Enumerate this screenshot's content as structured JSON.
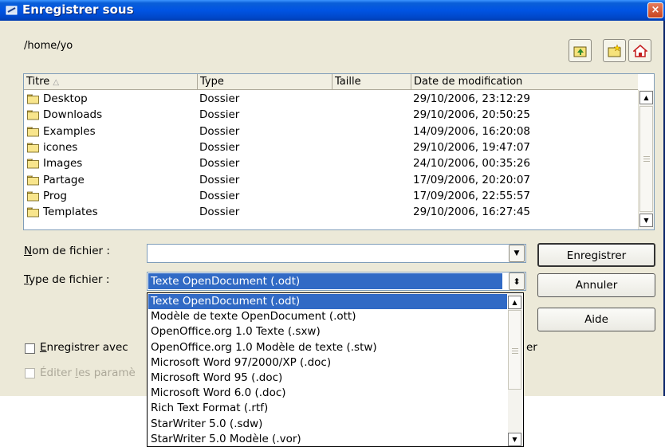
{
  "window": {
    "title": "Enregistrer sous",
    "close_glyph": "×",
    "current_path": "/home/yo",
    "toolbar": {
      "up_icon": "folder-up-icon",
      "new_folder_icon": "new-folder-icon",
      "home_icon": "home-icon"
    }
  },
  "file_list": {
    "columns": [
      "Titre",
      "Type",
      "Taille",
      "Date de modification"
    ],
    "sort_indicator": "△",
    "rows": [
      {
        "name": "Desktop",
        "type": "Dossier",
        "size": "",
        "date": "29/10/2006, 23:12:29"
      },
      {
        "name": "Downloads",
        "type": "Dossier",
        "size": "",
        "date": "29/10/2006, 20:50:25"
      },
      {
        "name": "Examples",
        "type": "Dossier",
        "size": "",
        "date": "14/09/2006, 16:20:08"
      },
      {
        "name": "icones",
        "type": "Dossier",
        "size": "",
        "date": "29/10/2006, 19:47:07"
      },
      {
        "name": "Images",
        "type": "Dossier",
        "size": "",
        "date": "24/10/2006, 00:35:26"
      },
      {
        "name": "Partage",
        "type": "Dossier",
        "size": "",
        "date": "17/09/2006, 20:20:07"
      },
      {
        "name": "Prog",
        "type": "Dossier",
        "size": "",
        "date": "17/09/2006, 22:55:57"
      },
      {
        "name": "Templates",
        "type": "Dossier",
        "size": "",
        "date": "29/10/2006, 16:27:45"
      }
    ]
  },
  "form": {
    "filename_label_accel": "N",
    "filename_label_rest": "om de fichier :",
    "filename_value": "",
    "filetype_label_accel": "T",
    "filetype_label_rest": "ype de fichier :",
    "filetype_selected": "Texte OpenDocument (.odt)",
    "save_with_password_accel": "E",
    "save_with_password_rest": "nregistrer avec",
    "save_with_password_tail": "er",
    "edit_filter_pre": "Éditer ",
    "edit_filter_accel": "l",
    "edit_filter_rest": "es paramè",
    "save_with_password_checked": false,
    "edit_filter_checked": false
  },
  "buttons": {
    "save": "Enregistrer",
    "cancel": "Annuler",
    "help": "Aide"
  },
  "filetype_options": [
    "Texte OpenDocument (.odt)",
    "Modèle de texte OpenDocument (.ott)",
    "OpenOffice.org 1.0 Texte (.sxw)",
    "OpenOffice.org 1.0 Modèle de texte (.stw)",
    "Microsoft Word 97/2000/XP (.doc)",
    "Microsoft Word 95 (.doc)",
    "Microsoft Word 6.0 (.doc)",
    "Rich Text Format (.rtf)",
    "StarWriter 5.0 (.sdw)",
    "StarWriter 5.0 Modèle (.vor)"
  ],
  "glyphs": {
    "dropdown_arrow": "▼",
    "updown_arrow": "◆",
    "scroll_up": "▲",
    "scroll_down": "▼"
  },
  "colors": {
    "titlebar": "#0054e3",
    "selection": "#316ac5",
    "dialog_bg": "#ece9d8"
  }
}
